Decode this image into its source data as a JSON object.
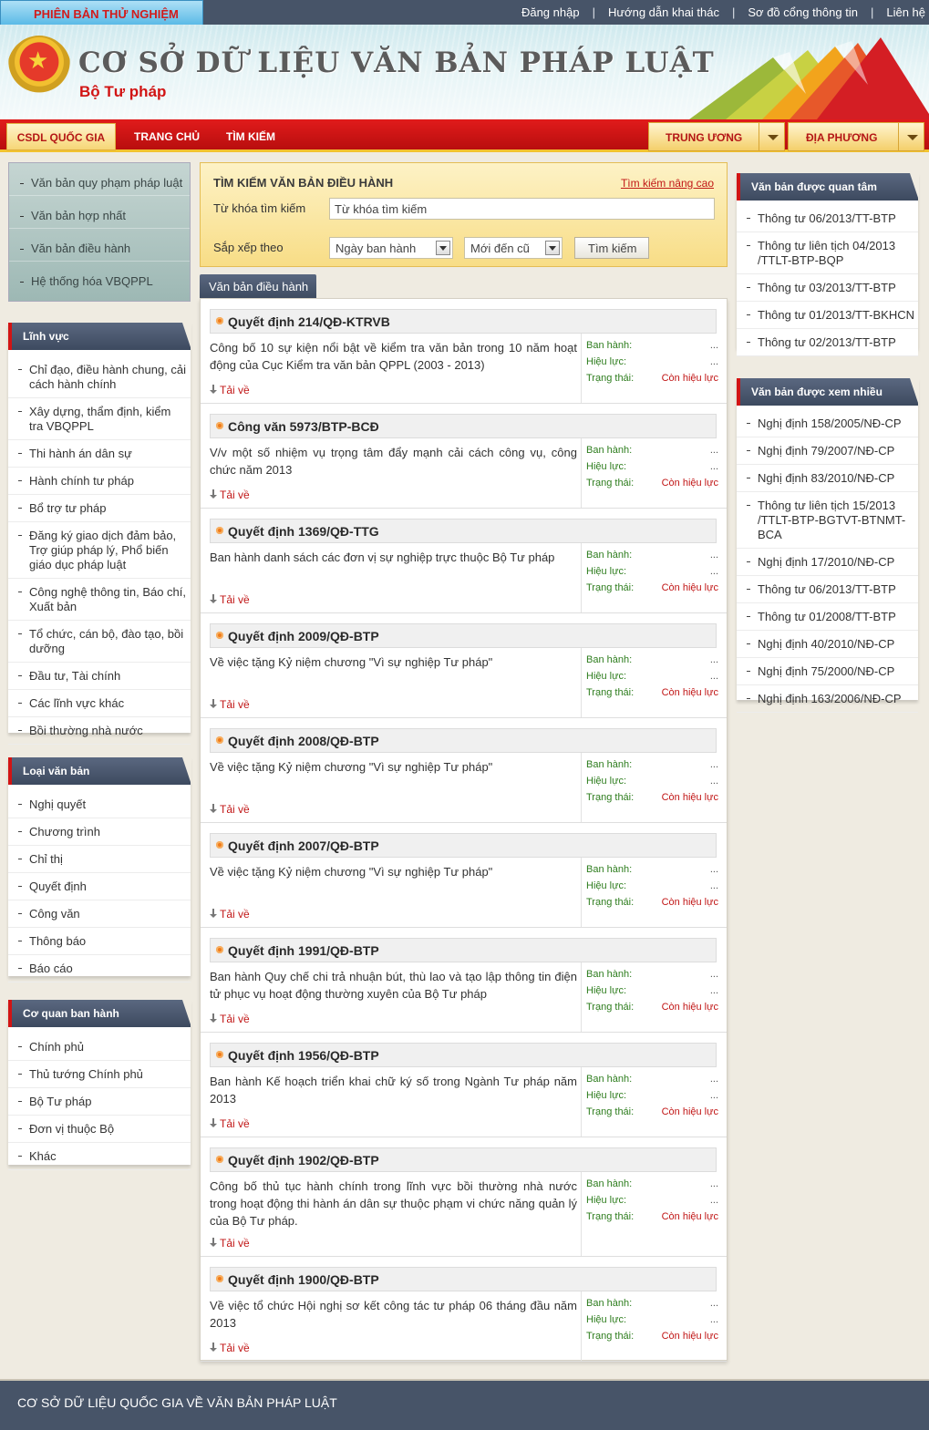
{
  "topbar": {
    "trial": "PHIÊN BẢN THỬ NGHIỆM",
    "links": [
      "Đăng nhập",
      "Hướng dẫn khai thác",
      "Sơ đồ cổng thông tin",
      "Liên hệ"
    ]
  },
  "header": {
    "title": "CƠ SỞ DỮ LIỆU VĂN BẢN PHÁP LUẬT",
    "subtitle": "Bộ Tư pháp"
  },
  "nav": {
    "csdl": "CSDL QUỐC GIA",
    "home": "TRANG CHỦ",
    "search": "TÌM KIẾM",
    "trunguong": "TRUNG ƯƠNG",
    "diaphuong": "ĐỊA PHƯƠNG"
  },
  "leftmenu": [
    "Văn bản quy phạm pháp luật",
    "Văn bản hợp nhất",
    "Văn bản điều hành",
    "Hệ thống hóa VBQPPL"
  ],
  "linhvuc": {
    "title": "Lĩnh vực",
    "items": [
      "Chỉ đạo, điều hành chung, cải cách hành chính",
      "Xây dựng, thẩm định, kiểm tra VBQPPL",
      "Thi hành án dân sự",
      "Hành chính tư pháp",
      "Bổ trợ tư pháp",
      "Đăng ký giao dịch đảm bảo, Trợ giúp pháp lý, Phổ biến giáo dục pháp luật",
      "Công nghệ thông tin, Báo chí, Xuất bản",
      "Tổ chức, cán bộ, đào tạo, bồi dưỡng",
      "Đầu tư, Tài chính",
      "Các lĩnh vực khác",
      "Bồi thường nhà nước"
    ]
  },
  "loaivanban": {
    "title": "Loại văn bản",
    "items": [
      "Nghị quyết",
      "Chương trình",
      "Chỉ thị",
      "Quyết định",
      "Công văn",
      "Thông báo",
      "Báo cáo"
    ]
  },
  "coquan": {
    "title": "Cơ quan ban hành",
    "items": [
      "Chính phủ",
      "Thủ tướng Chính phủ",
      "Bộ Tư pháp",
      "Đơn vị thuộc Bộ",
      "Khác"
    ]
  },
  "search": {
    "title": "TÌM KIẾM VĂN BẢN ĐIỀU HÀNH",
    "advanced": "Tìm kiếm nâng cao",
    "keyword_label": "Từ khóa tìm kiếm",
    "keyword_value": "Từ khóa tìm kiếm",
    "sort_label": "Sắp xếp theo",
    "sort_by": "Ngày ban hành",
    "sort_order": "Mới đến cũ",
    "button": "Tìm kiếm"
  },
  "tab": "Văn bản điều hành",
  "meta_labels": {
    "banhanh": "Ban hành:",
    "hieuluc": "Hiệu lực:",
    "trangthai": "Trạng thái:",
    "download": "Tải về"
  },
  "documents": [
    {
      "title": "Quyết định 214/QĐ-KTRVB",
      "desc": "Công bố 10 sự kiện nổi bật về kiểm tra văn bản trong 10 năm hoạt động của Cục Kiểm tra văn bản QPPL (2003 - 2013)",
      "banhanh": "...",
      "hieuluc": "...",
      "trangthai": "Còn hiệu lực"
    },
    {
      "title": "Công văn 5973/BTP-BCĐ",
      "desc": "V/v một số nhiệm vụ trọng tâm đẩy mạnh cải cách công vụ, công chức năm 2013",
      "banhanh": "...",
      "hieuluc": "...",
      "trangthai": "Còn hiệu lực"
    },
    {
      "title": "Quyết định 1369/QĐ-TTG",
      "desc": "Ban hành danh sách các đơn vị sự nghiệp trực thuộc Bộ Tư pháp",
      "banhanh": "...",
      "hieuluc": "...",
      "trangthai": "Còn hiệu lực"
    },
    {
      "title": "Quyết định 2009/QĐ-BTP",
      "desc": "Về việc tặng Kỷ niệm chương \"Vì sự nghiệp Tư pháp\"",
      "banhanh": "...",
      "hieuluc": "...",
      "trangthai": "Còn hiệu lực"
    },
    {
      "title": "Quyết định 2008/QĐ-BTP",
      "desc": "Về việc tặng Kỷ niệm chương \"Vì sự nghiệp Tư pháp\"",
      "banhanh": "...",
      "hieuluc": "...",
      "trangthai": "Còn hiệu lực"
    },
    {
      "title": "Quyết định 2007/QĐ-BTP",
      "desc": "Về việc tặng Kỷ niệm chương \"Vì sự nghiệp Tư pháp\"",
      "banhanh": "...",
      "hieuluc": "...",
      "trangthai": "Còn hiệu lực"
    },
    {
      "title": "Quyết định 1991/QĐ-BTP",
      "desc": "Ban hành Quy chế chi trả nhuận bút, thù lao và tạo lập thông tin điện tử phục vụ hoạt động thường xuyên của Bộ Tư pháp",
      "banhanh": "...",
      "hieuluc": "...",
      "trangthai": "Còn hiệu lực"
    },
    {
      "title": "Quyết định 1956/QĐ-BTP",
      "desc": "Ban hành Kế hoạch triển khai chữ ký số trong Ngành Tư pháp năm 2013",
      "banhanh": "...",
      "hieuluc": "...",
      "trangthai": "Còn hiệu lực"
    },
    {
      "title": "Quyết định 1902/QĐ-BTP",
      "desc": "Công bố thủ tục hành chính trong lĩnh vực bồi thường nhà nước trong hoạt động thi hành án dân sự thuộc phạm vi chức năng quản lý của Bộ Tư pháp.",
      "banhanh": "...",
      "hieuluc": "...",
      "trangthai": "Còn hiệu lực"
    },
    {
      "title": "Quyết định 1900/QĐ-BTP",
      "desc": "Về việc tổ chức Hội nghị sơ kết công tác tư pháp 06 tháng đầu năm 2013",
      "banhanh": "...",
      "hieuluc": "...",
      "trangthai": "Còn hiệu lực"
    }
  ],
  "quantam": {
    "title": "Văn bản được quan tâm",
    "items": [
      "Thông tư 06/2013/TT-BTP",
      "Thông tư liên tịch 04/2013 /TTLT-BTP-BQP",
      "Thông tư 03/2013/TT-BTP",
      "Thông tư 01/2013/TT-BKHCN",
      "Thông tư 02/2013/TT-BTP"
    ]
  },
  "xemnhieu": {
    "title": "Văn bản được xem nhiều",
    "items": [
      "Nghị định 158/2005/NĐ-CP",
      "Nghị định 79/2007/NĐ-CP",
      "Nghị định 83/2010/NĐ-CP",
      "Thông tư liên tịch 15/2013 /TTLT-BTP-BGTVT-BTNMT-BCA",
      "Nghị định 17/2010/NĐ-CP",
      "Thông tư 06/2013/TT-BTP",
      "Thông tư 01/2008/TT-BTP",
      "Nghị định 40/2010/NĐ-CP",
      "Nghị định 75/2000/NĐ-CP",
      "Nghị định 163/2006/NĐ-CP"
    ]
  },
  "footer": "CƠ SỞ DỮ LIỆU QUỐC GIA VỀ VĂN BẢN PHÁP LUẬT",
  "colors": {
    "brand_red": "#d11414",
    "nav_dark": "#475468",
    "gold": "#f2c230"
  }
}
